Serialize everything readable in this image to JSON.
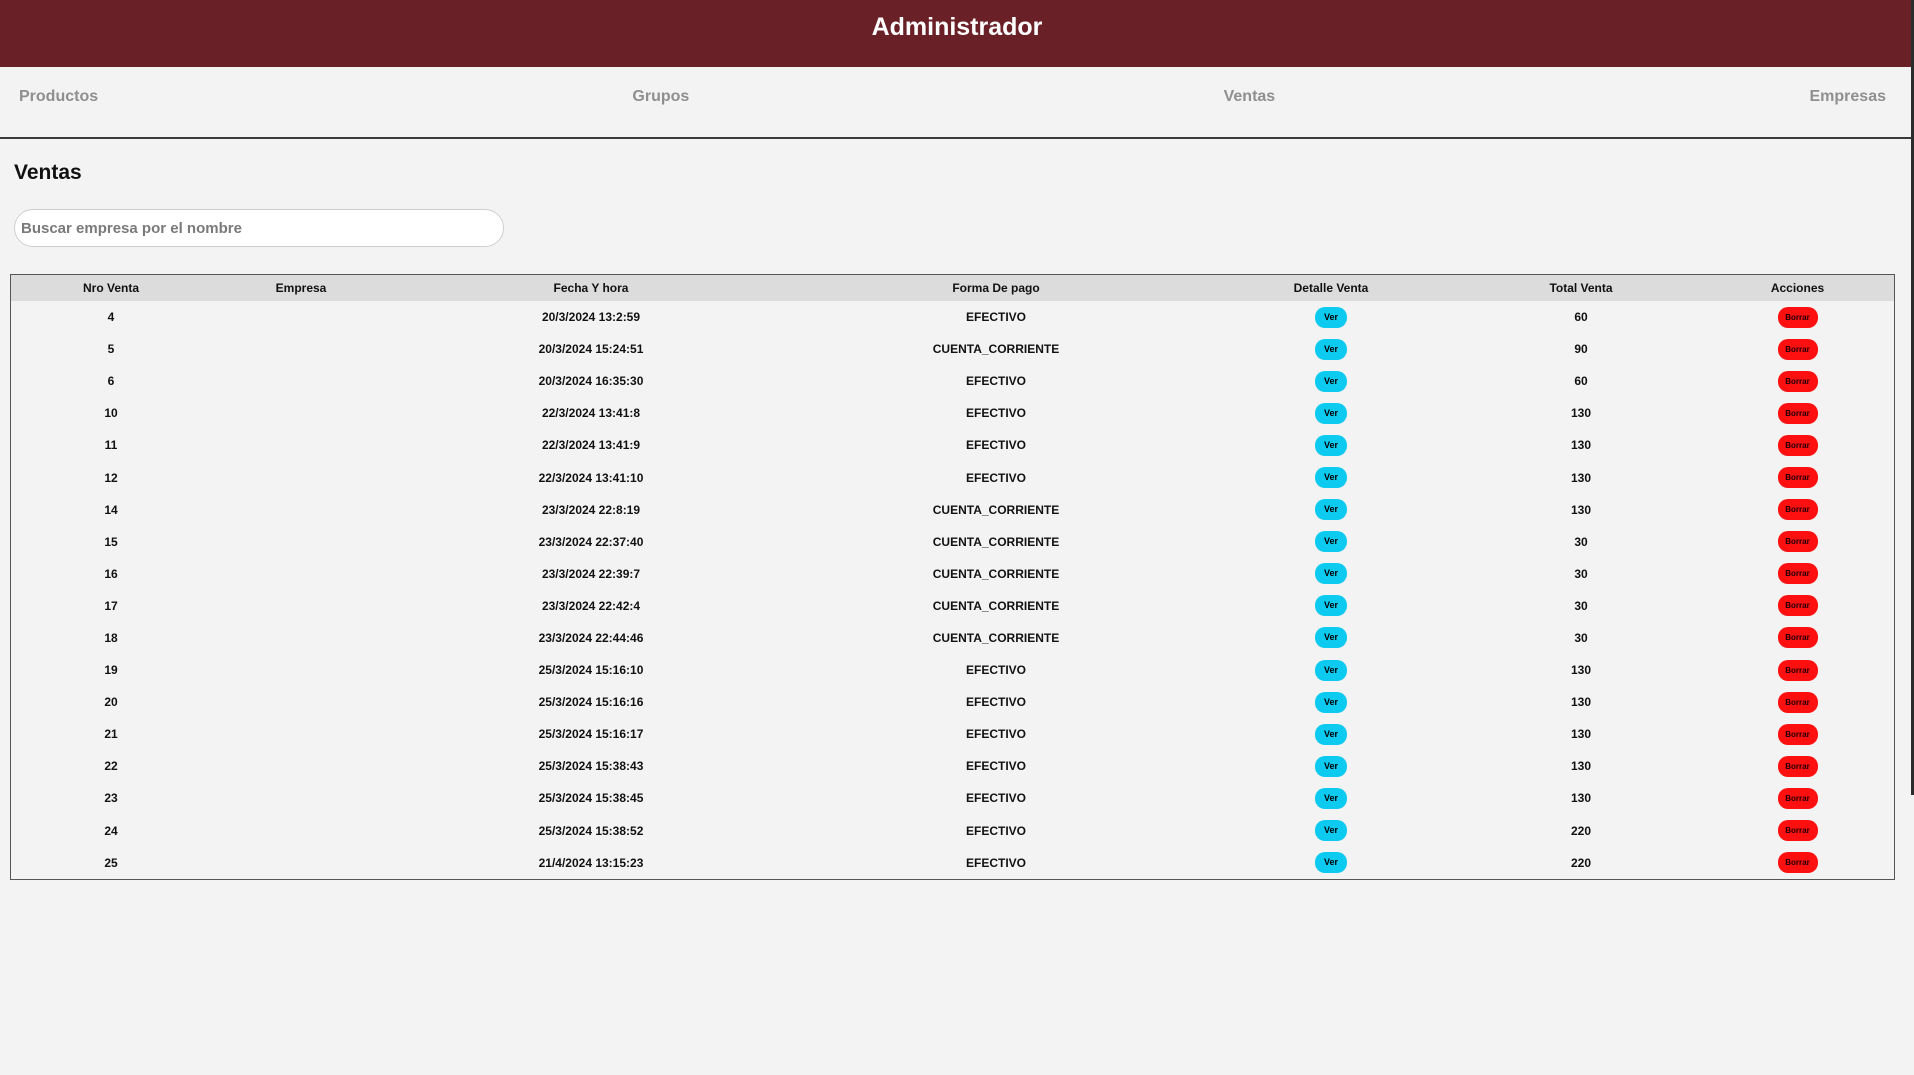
{
  "header": {
    "title": "Administrador"
  },
  "nav": {
    "items": [
      "Productos",
      "Grupos",
      "Ventas",
      "Empresas"
    ]
  },
  "main": {
    "title": "Ventas",
    "search_placeholder": "Buscar empresa por el nombre",
    "search_value": ""
  },
  "table": {
    "columns": [
      "Nro Venta",
      "Empresa",
      "Fecha Y hora",
      "Forma De pago",
      "Detalle Venta",
      "Total Venta",
      "Acciones"
    ],
    "ver_label": "Ver",
    "borrar_label": "Borrar",
    "rows": [
      {
        "nro": "4",
        "empresa": "",
        "fecha": "20/3/2024 13:2:59",
        "pago": "EFECTIVO",
        "total": "60"
      },
      {
        "nro": "5",
        "empresa": "",
        "fecha": "20/3/2024 15:24:51",
        "pago": "CUENTA_CORRIENTE",
        "total": "90"
      },
      {
        "nro": "6",
        "empresa": "",
        "fecha": "20/3/2024 16:35:30",
        "pago": "EFECTIVO",
        "total": "60"
      },
      {
        "nro": "10",
        "empresa": "",
        "fecha": "22/3/2024 13:41:8",
        "pago": "EFECTIVO",
        "total": "130"
      },
      {
        "nro": "11",
        "empresa": "",
        "fecha": "22/3/2024 13:41:9",
        "pago": "EFECTIVO",
        "total": "130"
      },
      {
        "nro": "12",
        "empresa": "",
        "fecha": "22/3/2024 13:41:10",
        "pago": "EFECTIVO",
        "total": "130"
      },
      {
        "nro": "14",
        "empresa": "",
        "fecha": "23/3/2024 22:8:19",
        "pago": "CUENTA_CORRIENTE",
        "total": "130"
      },
      {
        "nro": "15",
        "empresa": "",
        "fecha": "23/3/2024 22:37:40",
        "pago": "CUENTA_CORRIENTE",
        "total": "30"
      },
      {
        "nro": "16",
        "empresa": "",
        "fecha": "23/3/2024 22:39:7",
        "pago": "CUENTA_CORRIENTE",
        "total": "30"
      },
      {
        "nro": "17",
        "empresa": "",
        "fecha": "23/3/2024 22:42:4",
        "pago": "CUENTA_CORRIENTE",
        "total": "30"
      },
      {
        "nro": "18",
        "empresa": "",
        "fecha": "23/3/2024 22:44:46",
        "pago": "CUENTA_CORRIENTE",
        "total": "30"
      },
      {
        "nro": "19",
        "empresa": "",
        "fecha": "25/3/2024 15:16:10",
        "pago": "EFECTIVO",
        "total": "130"
      },
      {
        "nro": "20",
        "empresa": "",
        "fecha": "25/3/2024 15:16:16",
        "pago": "EFECTIVO",
        "total": "130"
      },
      {
        "nro": "21",
        "empresa": "",
        "fecha": "25/3/2024 15:16:17",
        "pago": "EFECTIVO",
        "total": "130"
      },
      {
        "nro": "22",
        "empresa": "",
        "fecha": "25/3/2024 15:38:43",
        "pago": "EFECTIVO",
        "total": "130"
      },
      {
        "nro": "23",
        "empresa": "",
        "fecha": "25/3/2024 15:38:45",
        "pago": "EFECTIVO",
        "total": "130"
      },
      {
        "nro": "24",
        "empresa": "",
        "fecha": "25/3/2024 15:38:52",
        "pago": "EFECTIVO",
        "total": "220"
      },
      {
        "nro": "25",
        "empresa": "",
        "fecha": "21/4/2024 13:15:23",
        "pago": "EFECTIVO",
        "total": "220"
      }
    ]
  },
  "colors": {
    "header_bg": "#6a2027",
    "ver_button": "#0dcaf0",
    "borrar_button": "#ff1010",
    "table_head_bg": "#dcdcdc",
    "page_bg": "#f3f3f3"
  }
}
